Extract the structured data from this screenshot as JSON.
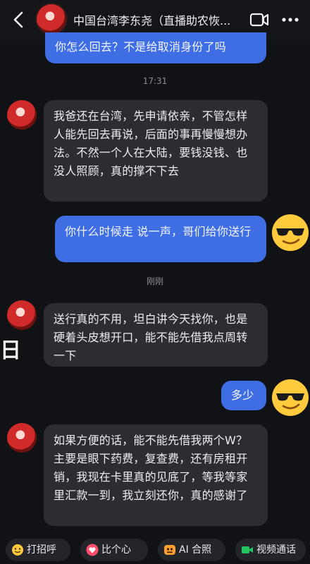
{
  "header": {
    "title": "中国台湾李东尧（直播助农恢..."
  },
  "messages": [
    {
      "sender": "me",
      "text": "你怎么回去？不是给取消身份了吗"
    },
    {
      "type": "time",
      "text": "17:31"
    },
    {
      "sender": "them",
      "text": "我爸还在台湾，先申请依亲，不管怎样人能先回去再说，后面的事再慢慢想办法。不然一个人在大陆，要钱没钱、也没人照顾，真的撑不下去"
    },
    {
      "sender": "me",
      "text": "你什么时候走 说一声，哥们给你送行"
    },
    {
      "type": "time",
      "text": "刚刚"
    },
    {
      "sender": "them",
      "text": "送行真的不用，坦白讲今天找你，也是硬着头皮想开口，能不能先借我点周转一下"
    },
    {
      "sender": "me",
      "text": "多少"
    },
    {
      "sender": "them",
      "text": "如果方便的话，能不能先借我两个W？主要是眼下药费，复查费，还有房租开销，我现在卡里真的见底了，等我等家里汇款一到，我立刻还你，真的感谢了"
    }
  ],
  "watermark_text": "日醬",
  "bottom_actions": [
    {
      "label": "打招呼",
      "icon": "wave-emoji-icon"
    },
    {
      "label": "比个心",
      "icon": "heart-icon"
    },
    {
      "label": "AI 合照",
      "icon": "ai-photo-icon"
    },
    {
      "label": "视频通话",
      "icon": "video-call-icon"
    }
  ],
  "colors": {
    "background": "#111216",
    "my_bubble": "#3f6de3",
    "their_bubble": "#2c2c31"
  }
}
